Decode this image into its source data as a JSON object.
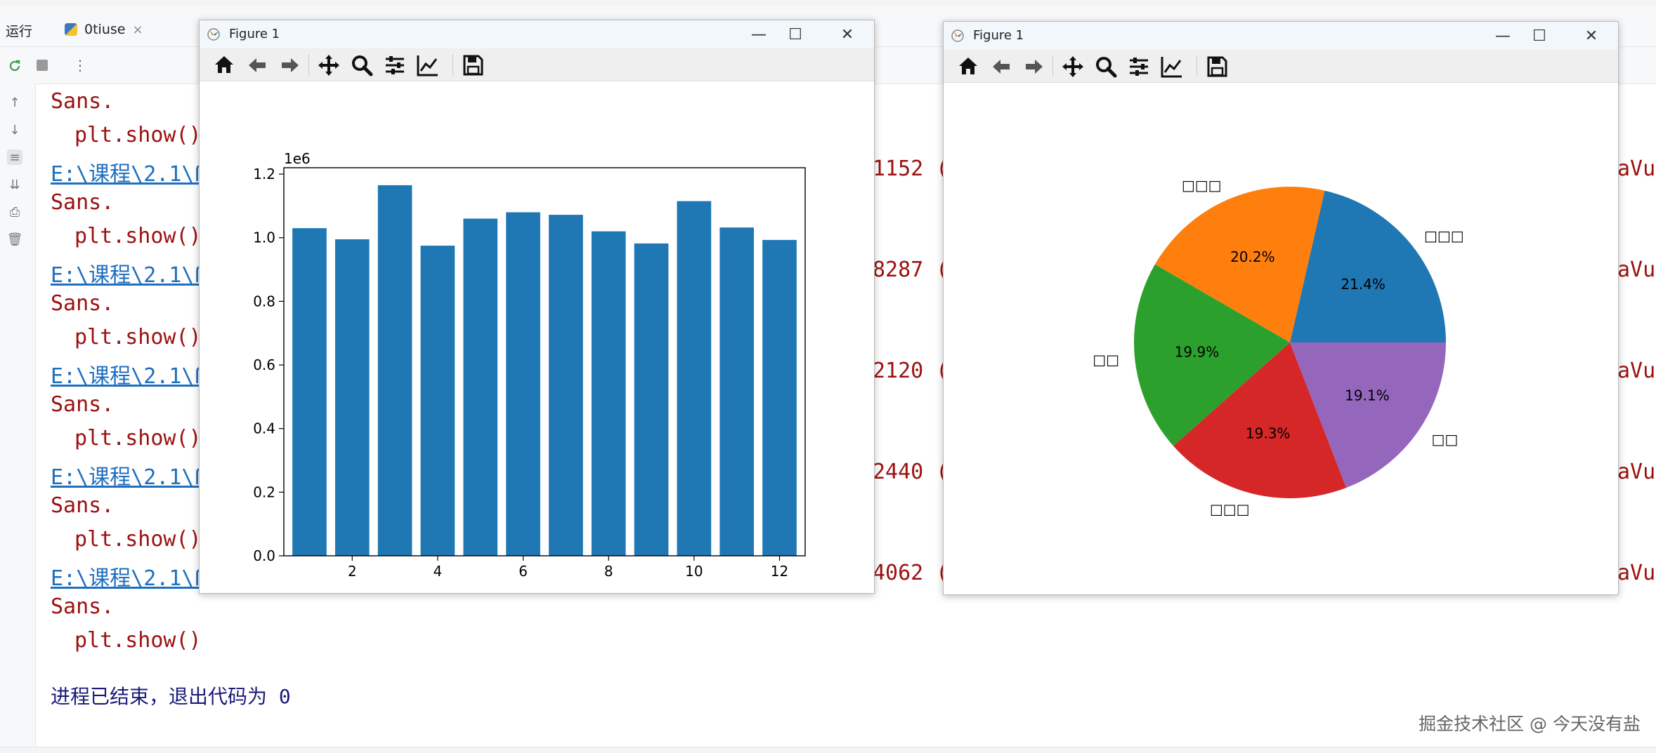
{
  "ide": {
    "run_label": "运行",
    "run_tab": "0tiuse",
    "close_glyph": "×"
  },
  "console": {
    "lines": [
      {
        "text": "Sans.",
        "kind": "red"
      },
      {
        "text": "plt.show()",
        "kind": "red"
      },
      {
        "text": "E:\\课程\\2.1\\ß",
        "kind": "link"
      },
      {
        "text": "Sans.",
        "kind": "red"
      },
      {
        "text": "plt.show()",
        "kind": "red"
      },
      {
        "text": "E:\\课程\\2.1\\ß",
        "kind": "link"
      },
      {
        "text": "Sans.",
        "kind": "red"
      },
      {
        "text": "plt.show()",
        "kind": "red"
      },
      {
        "text": "E:\\课程\\2.1\\ß",
        "kind": "link"
      },
      {
        "text": "Sans.",
        "kind": "red"
      },
      {
        "text": "plt.show()",
        "kind": "red"
      },
      {
        "text": "E:\\课程\\2.1\\ß",
        "kind": "link"
      },
      {
        "text": "Sans.",
        "kind": "red"
      },
      {
        "text": "plt.show()",
        "kind": "red"
      },
      {
        "text": "E:\\课程\\2.1\\ß",
        "kind": "link"
      },
      {
        "text": "Sans.",
        "kind": "red"
      },
      {
        "text": "plt.show()",
        "kind": "red"
      }
    ],
    "mid_fragments": [
      "1152 (",
      "8287 (",
      "2120 (",
      "2440 (",
      "4062 ("
    ],
    "right_fragments": [
      "aVu",
      "aVu",
      "aVu",
      "aVu",
      "aVu"
    ],
    "exit_message": "进程已结束，退出代码为 0",
    "watermark": "掘金技术社区 @ 今天没有盐"
  },
  "figures": {
    "bar_window": {
      "title": "Figure 1"
    },
    "pie_window": {
      "title": "Figure 1"
    }
  },
  "toolbar_icons": [
    "home-icon",
    "back-arrow-icon",
    "forward-arrow-icon",
    "pan-move-icon",
    "zoom-magnifier-icon",
    "configure-subplots-icon",
    "edit-axis-icon",
    "save-floppy-icon"
  ],
  "chart_data": [
    {
      "type": "bar",
      "categories": [
        1,
        2,
        3,
        4,
        5,
        6,
        7,
        8,
        9,
        10,
        11,
        12
      ],
      "values": [
        1030000,
        995000,
        1165000,
        975000,
        1060000,
        1080000,
        1072000,
        1020000,
        982000,
        1115000,
        1032000,
        993000
      ],
      "xticks": [
        "2",
        "4",
        "6",
        "8",
        "10",
        "12"
      ],
      "yticks": [
        "0.0",
        "0.2",
        "0.4",
        "0.6",
        "0.8",
        "1.0",
        "1.2"
      ],
      "offset_text": "1e6",
      "ylim": [
        0,
        1220000
      ],
      "xlim": [
        0.4,
        12.6
      ],
      "color": "#1f77b4"
    },
    {
      "type": "pie",
      "slices": [
        {
          "label": "□□□",
          "pct_label": "21.4%",
          "value": 21.4,
          "color": "#1f77b4"
        },
        {
          "label": "□□□",
          "pct_label": "20.2%",
          "value": 20.2,
          "color": "#ff7f0e"
        },
        {
          "label": "□□",
          "pct_label": "19.9%",
          "value": 19.9,
          "color": "#2ca02c"
        },
        {
          "label": "□□□",
          "pct_label": "19.3%",
          "value": 19.3,
          "color": "#d62728"
        },
        {
          "label": "□□",
          "pct_label": "19.1%",
          "value": 19.1,
          "color": "#9467bd"
        }
      ]
    }
  ]
}
